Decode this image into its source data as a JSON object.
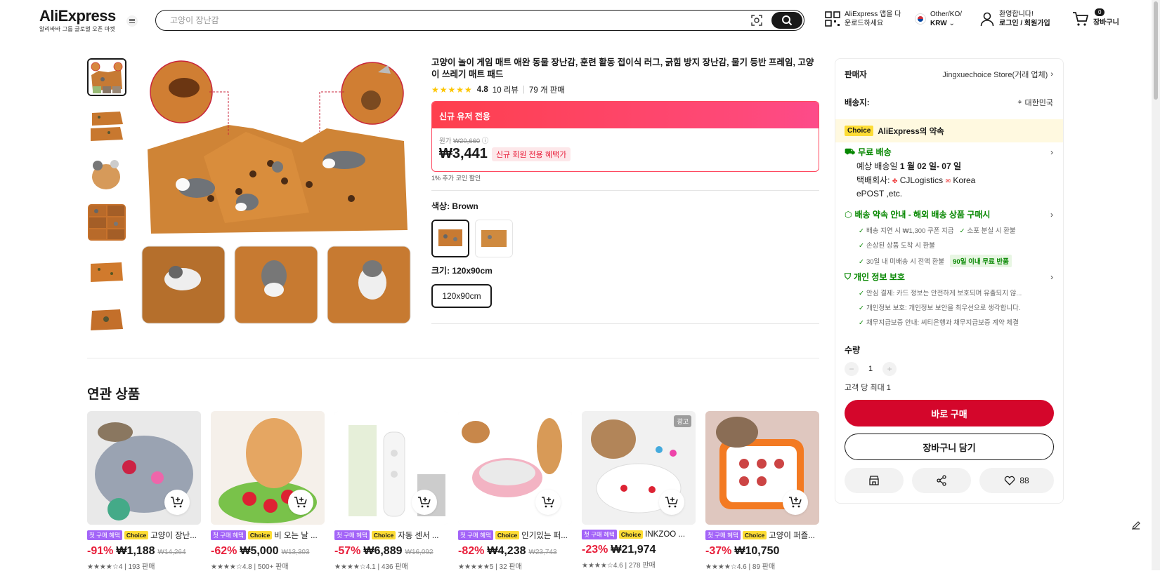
{
  "header": {
    "logo": "AliExpress",
    "logo_sub": "알리바바 그룹 글로벌 오픈 마켓",
    "search_placeholder": "고양이 장난감",
    "app_download": [
      "AliExpress 앱을 다",
      "운로드하세요"
    ],
    "region": "Other/KO/",
    "currency": "KRW",
    "greeting": "환영합니다!",
    "login": "로그인 / 회원가입",
    "cart_count": "0",
    "cart_label": "장바구니"
  },
  "product": {
    "title": "고양이 놀이 게임 매트 애완 동물 장난감, 훈련 활동 접이식 러그, 긁힘 방지 장난감, 물기 등반 프레임, 고양이 쓰레기 매트 패드",
    "stars": "★★★★★",
    "rating": "4.8",
    "reviews": "10 리뷰",
    "sold": "79 개 판매",
    "deal_header": "신규 유저 전용",
    "orig_label": "원가",
    "orig_price": "₩20,660",
    "price": "₩3,441",
    "new_member_tag": "신규 회원 전용 혜택가",
    "coin_note": "1% 추가 코인 할인",
    "color_label": "색상: ",
    "color_value": "Brown",
    "size_label": "크기: ",
    "size_value": "120x90cm",
    "size_option": "120x90cm"
  },
  "related": {
    "title": "연관 상품",
    "first_tag": "첫 구매 혜택",
    "choice_tag": "Choice",
    "ad_tag": "광고",
    "items": [
      {
        "name": "고양이 장난...",
        "discount": "-91%",
        "price": "₩1,188",
        "orig": "₩14,264",
        "meta": "★★★★☆4 | 193 판매"
      },
      {
        "name": "비 오는 날 ...",
        "discount": "-62%",
        "price": "₩5,000",
        "orig": "₩13,303",
        "meta": "★★★★☆4.8 | 500+ 판매"
      },
      {
        "name": "자동 센서 ...",
        "discount": "-57%",
        "price": "₩6,889",
        "orig": "₩16,092",
        "meta": "★★★★☆4.1 | 436 판매"
      },
      {
        "name": "인기있는 퍼...",
        "discount": "-82%",
        "price": "₩4,238",
        "orig": "₩23,743",
        "meta": "★★★★★5 | 32 판매"
      },
      {
        "name": "INKZOO ...",
        "discount": "-23%",
        "price": "₩21,974",
        "orig": "",
        "meta": "★★★★☆4.6 | 278 판매"
      },
      {
        "name": "고양이 퍼즐...",
        "discount": "-37%",
        "price": "₩10,750",
        "orig": "",
        "meta": "★★★★☆4.6 | 89 판매"
      }
    ]
  },
  "sidebar": {
    "seller_label": "판매자",
    "seller_value": "Jingxuechoice Store(거래 업체)",
    "ship_label": "배송지:",
    "ship_value": "대한민국",
    "choice_badge": "Choice",
    "choice_promise": "AliExpress의 약속",
    "free_ship": "무료 배송",
    "eta_prefix": "예상 배송일 ",
    "eta": "1 월 02 일- 07 일",
    "carrier_prefix": "택배회사: ",
    "carrier1": "CJLogistics",
    "carrier2": "Korea",
    "carrier3": "ePOST ,etc.",
    "promise_title": "배송 약속 안내 - 해외 배송 상품 구매시",
    "promise_items": [
      "배송 지연 시 ₩1,300 쿠폰 지급",
      "소포 분실 시 환불",
      "손상된 상품 도착 시 환불",
      "30일 내 미배송 시 전액 환불"
    ],
    "return_tag": "90일 이내 무료 반품",
    "privacy_title": "개인 정보 보호",
    "privacy_items": [
      "안심 결제: 카드 정보는 안전하게 보호되며 유출되지 않...",
      "개인정보 보호: 개인정보 보안을 최우선으로 생각합니다.",
      "채무지급보증 안내: 씨티은행과 채무지급보증 계약 체결"
    ],
    "qty_label": "수량",
    "qty_value": "1",
    "limit": "고객 당 최대 1",
    "buy_now": "바로 구매",
    "add_cart": "장바구니 담기",
    "wish_count": "88"
  },
  "colors": {
    "accent_red": "#d4062b",
    "deal_pink": "#fe4960",
    "green": "#068700",
    "choice_yellow": "#fddc35",
    "first_purple": "#a364f8"
  },
  "icons": [
    "menu-icon",
    "image-search-icon",
    "search-icon",
    "qr-icon",
    "flag-icon",
    "user-icon",
    "cart-icon",
    "store-icon",
    "share-icon",
    "heart-icon",
    "edit-icon",
    "truck-icon",
    "shield-icon"
  ]
}
